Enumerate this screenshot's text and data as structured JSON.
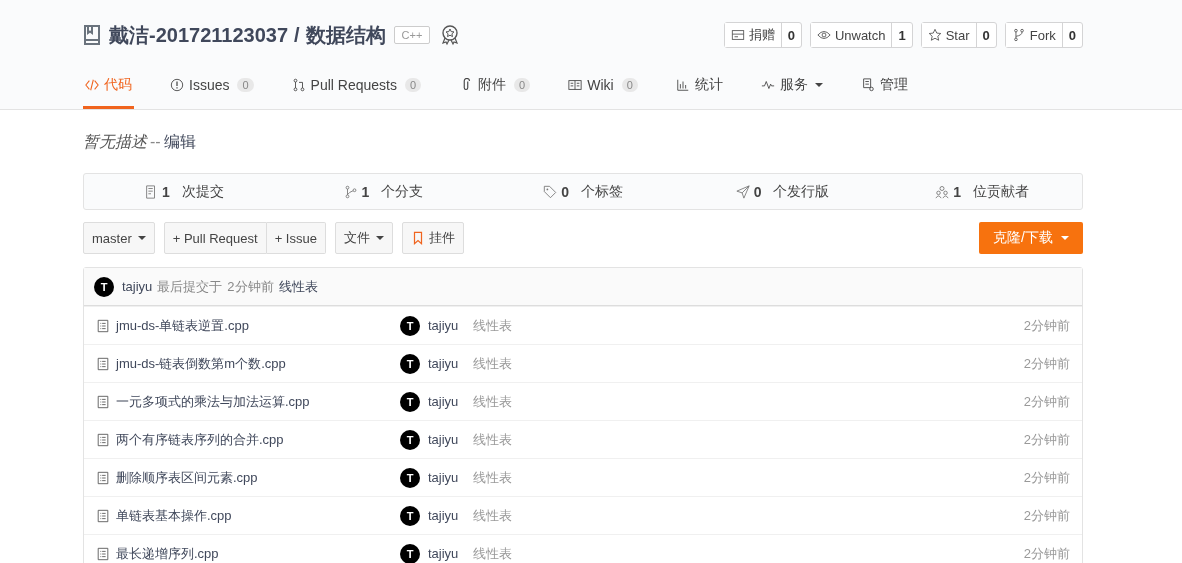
{
  "repo": {
    "owner": "戴洁-201721123037",
    "separator": "/",
    "name": "数据结构",
    "language": "C++"
  },
  "actions": [
    {
      "label": "捐赠",
      "count": "0"
    },
    {
      "label": "Unwatch",
      "count": "1"
    },
    {
      "label": "Star",
      "count": "0"
    },
    {
      "label": "Fork",
      "count": "0"
    }
  ],
  "tabs": [
    {
      "label": "代码",
      "selected": true
    },
    {
      "label": "Issues",
      "count": "0",
      "selected": false
    },
    {
      "label": "Pull Requests",
      "count": "0",
      "selected": false
    },
    {
      "label": "附件",
      "count": "0",
      "selected": false
    },
    {
      "label": "Wiki",
      "count": "0",
      "selected": false
    },
    {
      "label": "统计",
      "selected": false
    },
    {
      "label": "服务",
      "dropdown": true,
      "selected": false
    },
    {
      "label": "管理",
      "selected": false
    }
  ],
  "description": {
    "text": "暂无描述",
    "separator": "--",
    "edit_link": "编辑"
  },
  "stats": [
    {
      "number": "1",
      "label": "次提交"
    },
    {
      "number": "1",
      "label": "个分支"
    },
    {
      "number": "0",
      "label": "个标签"
    },
    {
      "number": "0",
      "label": "个发行版"
    },
    {
      "number": "1",
      "label": "位贡献者"
    }
  ],
  "toolbar": {
    "branch": "master",
    "new_pull_request": "+ Pull Request",
    "new_issue": "+ Issue",
    "files": "文件",
    "widget": "挂件",
    "clone": "克隆/下载"
  },
  "last_commit": {
    "avatar_letter": "T",
    "author": "tajiyu",
    "text": "最后提交于",
    "time": "2分钟前",
    "message": "线性表"
  },
  "files": [
    {
      "name": "jmu-ds-单链表逆置.cpp",
      "avatar_letter": "T",
      "author": "tajiyu",
      "message": "线性表",
      "time": "2分钟前"
    },
    {
      "name": "jmu-ds-链表倒数第m个数.cpp",
      "avatar_letter": "T",
      "author": "tajiyu",
      "message": "线性表",
      "time": "2分钟前"
    },
    {
      "name": "一元多项式的乘法与加法运算.cpp",
      "avatar_letter": "T",
      "author": "tajiyu",
      "message": "线性表",
      "time": "2分钟前"
    },
    {
      "name": "两个有序链表序列的合并.cpp",
      "avatar_letter": "T",
      "author": "tajiyu",
      "message": "线性表",
      "time": "2分钟前"
    },
    {
      "name": "删除顺序表区间元素.cpp",
      "avatar_letter": "T",
      "author": "tajiyu",
      "message": "线性表",
      "time": "2分钟前"
    },
    {
      "name": "单链表基本操作.cpp",
      "avatar_letter": "T",
      "author": "tajiyu",
      "message": "线性表",
      "time": "2分钟前"
    },
    {
      "name": "最长递增序列.cpp",
      "avatar_letter": "T",
      "author": "tajiyu",
      "message": "线性表",
      "time": "2分钟前"
    }
  ]
}
